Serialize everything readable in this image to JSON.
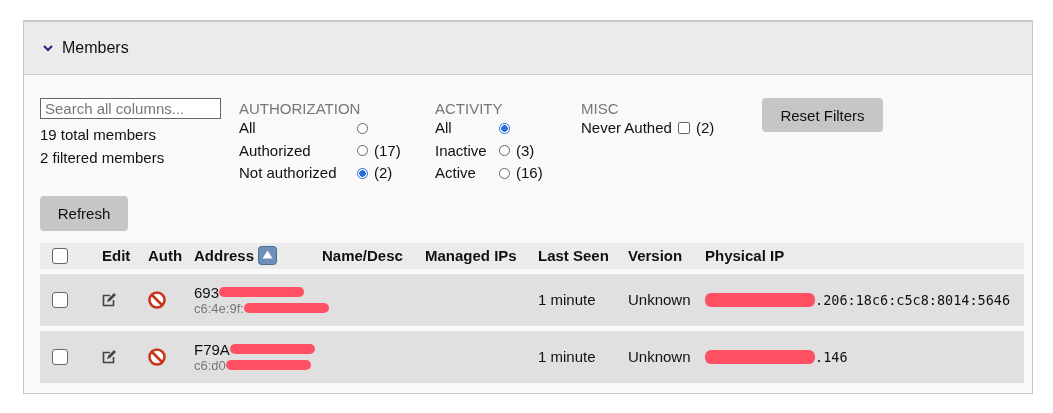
{
  "panel": {
    "title": "Members",
    "expanded": true
  },
  "search": {
    "placeholder": "Search all columns..."
  },
  "summary": [
    "19 total members",
    "2 filtered members"
  ],
  "filters": [
    {
      "title": "AUTHORIZATION",
      "kind": "radio",
      "options": [
        {
          "label": "All",
          "selected": false
        },
        {
          "label": "Authorized",
          "selected": false,
          "count": "(17)"
        },
        {
          "label": "Not authorized",
          "selected": true,
          "count": "(2)"
        }
      ]
    },
    {
      "title": "ACTIVITY",
      "kind": "radio",
      "options": [
        {
          "label": "All",
          "selected": true
        },
        {
          "label": "Inactive",
          "selected": false,
          "count": "(3)"
        },
        {
          "label": "Active",
          "selected": false,
          "count": "(16)"
        }
      ]
    },
    {
      "title": "MISC",
      "kind": "checkbox",
      "options": [
        {
          "label": "Never Authed",
          "checked": false,
          "count": "(2)"
        }
      ]
    }
  ],
  "reset_button": "Reset Filters",
  "refresh_button": "Refresh",
  "table": {
    "select_all_checked": false,
    "columns": [
      {
        "label": "Edit"
      },
      {
        "label": "Auth"
      },
      {
        "label": "Address",
        "sorted": true
      },
      {
        "label": "Name/Desc"
      },
      {
        "label": "Managed IPs"
      },
      {
        "label": "Last Seen"
      },
      {
        "label": "Version"
      },
      {
        "label": "Physical IP"
      }
    ],
    "rows": [
      {
        "checked": false,
        "address": "693",
        "mac": "c6:4e:9f:",
        "last_seen": "1 minute",
        "version": "Unknown",
        "physical_ip": ".206:18c6:c5c8:8014:5646"
      },
      {
        "checked": false,
        "address": "F79A",
        "mac": "c6:d0",
        "last_seen": "1 minute",
        "version": "Unknown",
        "physical_ip": ".146"
      }
    ]
  }
}
